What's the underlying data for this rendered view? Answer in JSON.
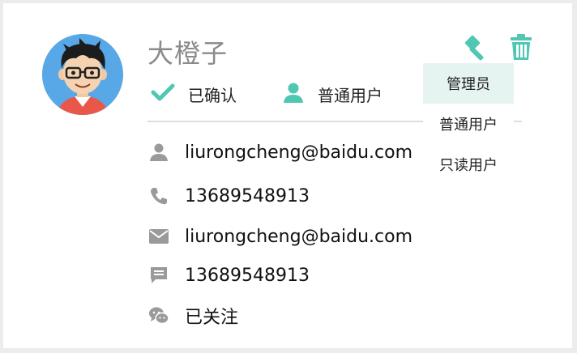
{
  "user": {
    "name": "大橙子",
    "status_label": "已确认",
    "role_label": "普通用户"
  },
  "contacts": [
    {
      "icon": "person-icon",
      "value": "liurongcheng@baidu.com"
    },
    {
      "icon": "phone-icon",
      "value": "13689548913"
    },
    {
      "icon": "mail-icon",
      "value": "liurongcheng@baidu.com"
    },
    {
      "icon": "message-icon",
      "value": "13689548913"
    },
    {
      "icon": "wechat-icon",
      "value": "已关注"
    }
  ],
  "actions": {
    "role_tool_icon": "hammer-icon",
    "delete_icon": "trash-icon"
  },
  "role_menu": {
    "items": [
      "管理员",
      "普通用户",
      "只读用户"
    ],
    "selected_index": 0
  },
  "colors": {
    "accent": "#4fc7b3",
    "icon_gray": "#9a9a9a",
    "menu_active_bg": "#e6f4f1",
    "avatar_bg": "#58a8e8"
  }
}
